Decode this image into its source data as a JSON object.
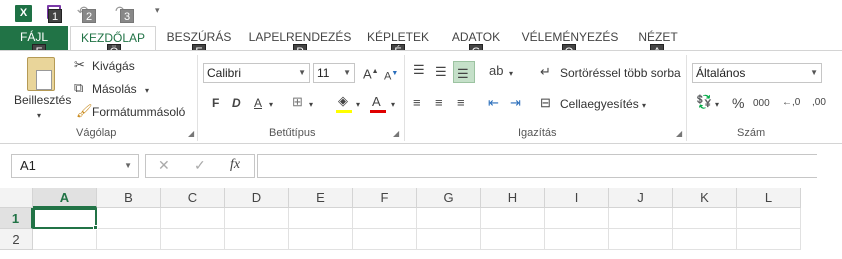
{
  "qat": {
    "app_icon": "X",
    "keytips": [
      "1",
      "2",
      "3"
    ]
  },
  "tabs": [
    {
      "label": "FÁJL",
      "keytip": "F"
    },
    {
      "label": "KEZDŐLAP",
      "keytip": "Ö"
    },
    {
      "label": "BESZÚRÁS",
      "keytip": "E"
    },
    {
      "label": "LAPELRENDEZÉS",
      "keytip": "P"
    },
    {
      "label": "KÉPLETEK",
      "keytip": "É"
    },
    {
      "label": "ADATOK",
      "keytip": "G"
    },
    {
      "label": "VÉLEMÉNYEZÉS",
      "keytip": "O"
    },
    {
      "label": "NÉZET",
      "keytip": "A"
    }
  ],
  "clipboard": {
    "paste_label": "Beillesztés",
    "cut_label": "Kivágás",
    "copy_label": "Másolás",
    "format_painter_label": "Formátummásoló",
    "group_label": "Vágólap"
  },
  "font": {
    "font_name": "Calibri",
    "font_size": "11",
    "bold": "F",
    "italic": "D",
    "underline": "A",
    "font_color": "A",
    "group_label": "Betűtípus"
  },
  "alignment": {
    "wrap_label": "Sortöréssel több sorba",
    "merge_label": "Cellaegyesítés",
    "group_label": "Igazítás"
  },
  "number": {
    "format_value": "Általános",
    "percent": "%",
    "thousands": "000",
    "group_label": "Szám"
  },
  "formula_bar": {
    "name_box": "A1",
    "cancel": "✕",
    "enter": "✓",
    "fx": "fx"
  },
  "grid": {
    "columns": [
      "A",
      "B",
      "C",
      "D",
      "E",
      "F",
      "G",
      "H",
      "I",
      "J",
      "K",
      "L"
    ],
    "rows": [
      "1",
      "2"
    ]
  },
  "colors": {
    "accent": "#217346",
    "file_tab": "#217346"
  }
}
